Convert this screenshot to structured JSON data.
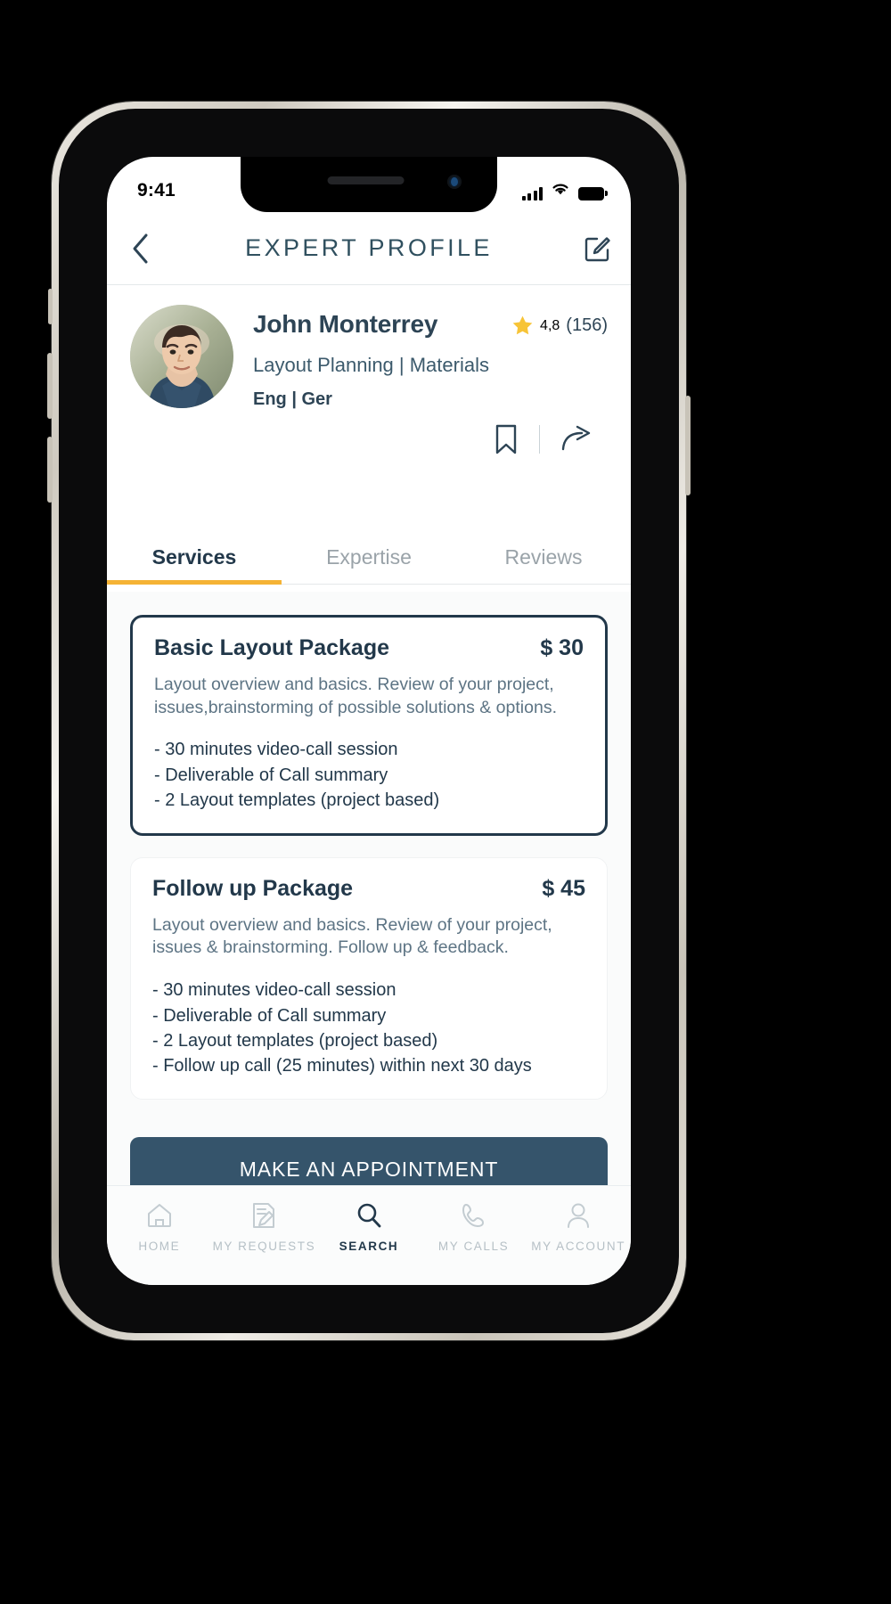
{
  "status_bar": {
    "time": "9:41",
    "signal_icon": "cellular-signal-icon",
    "wifi_icon": "wifi-icon",
    "battery_icon": "battery-icon"
  },
  "header": {
    "back_icon": "chevron-left-icon",
    "title": "EXPERT PROFILE",
    "edit_icon": "edit-square-icon"
  },
  "profile": {
    "avatar_alt": "expert-avatar",
    "name": "John Monterrey",
    "rating_star_icon": "star-icon",
    "rating_value": "4,8",
    "rating_count": "(156)",
    "specialty": "Layout Planning | Materials",
    "languages": "Eng | Ger",
    "bookmark_icon": "bookmark-icon",
    "share_icon": "share-arrow-icon"
  },
  "tabs": [
    {
      "label": "Services",
      "active": true
    },
    {
      "label": "Expertise",
      "active": false
    },
    {
      "label": "Reviews",
      "active": false
    }
  ],
  "services": [
    {
      "title": "Basic Layout Package",
      "price": "$ 30",
      "description": "Layout overview and basics. Review of your project, issues,brainstorming of possible solutions & options.",
      "items": [
        "- 30 minutes video-call session",
        "- Deliverable of Call summary",
        "- 2 Layout templates (project based)"
      ],
      "selected": true
    },
    {
      "title": "Follow up Package",
      "price": "$ 45",
      "description": "Layout overview and basics. Review of your project, issues & brainstorming. Follow up & feedback.",
      "items": [
        "- 30 minutes video-call session",
        "- Deliverable of Call summary",
        "- 2 Layout templates (project based)",
        "- Follow up call (25 minutes) within next 30 days"
      ],
      "selected": false
    }
  ],
  "cta": {
    "label": "MAKE AN APPOINTMENT"
  },
  "bottom_nav": [
    {
      "label": "HOME",
      "icon": "home-icon",
      "active": false
    },
    {
      "label": "MY REQUESTS",
      "icon": "document-edit-icon",
      "active": false
    },
    {
      "label": "SEARCH",
      "icon": "search-icon",
      "active": true
    },
    {
      "label": "MY CALLS",
      "icon": "phone-icon",
      "active": false
    },
    {
      "label": "MY ACCOUNT",
      "icon": "person-icon",
      "active": false
    }
  ],
  "colors": {
    "accent_yellow": "#f5b335",
    "primary_navy": "#22384a",
    "cta_blue": "#35546b",
    "muted_gray": "#9aa3a9"
  }
}
